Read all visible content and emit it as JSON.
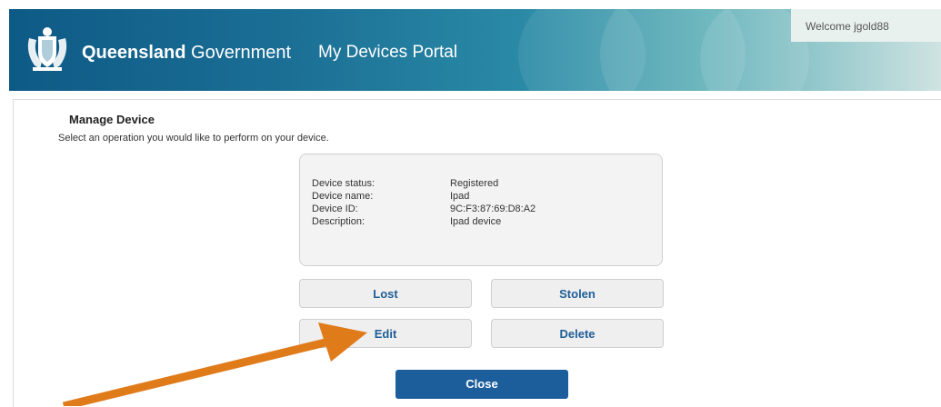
{
  "header": {
    "brand_bold": "Queensland",
    "brand_rest": " Government",
    "portal_title": "My Devices Portal",
    "welcome": "Welcome jgold88"
  },
  "page": {
    "title": "Manage Device",
    "subtitle": "Select an operation you would like to perform on your device."
  },
  "device": {
    "status_label": "Device status:",
    "status_value": "Registered",
    "name_label": "Device name:",
    "name_value": "Ipad",
    "id_label": "Device ID:",
    "id_value": "9C:F3:87:69:D8:A2",
    "description_label": "Description:",
    "description_value": "Ipad device"
  },
  "buttons": {
    "lost": "Lost",
    "stolen": "Stolen",
    "edit": "Edit",
    "delete": "Delete",
    "close": "Close"
  },
  "colors": {
    "accent": "#1c5d9c",
    "annotation_arrow": "#e07b1a"
  },
  "icons": {
    "crest": "queensland-crest-icon",
    "annotation": "annotation-arrow"
  }
}
